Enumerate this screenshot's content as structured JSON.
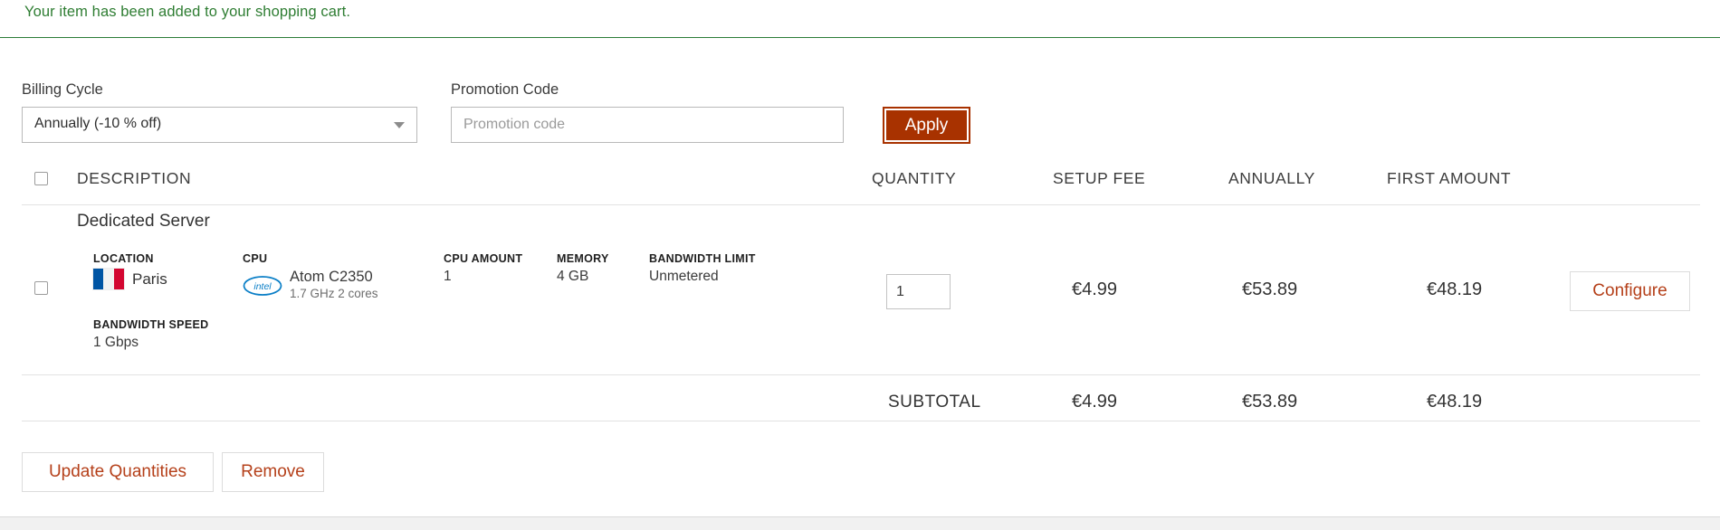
{
  "alert": {
    "message": "Your item has been added to your shopping cart.",
    "color": "#2e7d32"
  },
  "form": {
    "billing_cycle_label": "Billing Cycle",
    "billing_cycle_value": "Annually (-10 % off)",
    "promotion_label": "Promotion Code",
    "promotion_placeholder": "Promotion code",
    "promotion_value": "",
    "apply_label": "Apply",
    "apply_color": "#a83200"
  },
  "table": {
    "headers": {
      "description": "DESCRIPTION",
      "quantity": "QUANTITY",
      "setup_fee": "SETUP FEE",
      "annually": "ANNUALLY",
      "first_amount": "FIRST AMOUNT"
    },
    "item": {
      "title": "Dedicated Server",
      "quantity": "1",
      "setup_fee": "€4.99",
      "annually": "€53.89",
      "first_amount": "€48.19",
      "configure_label": "Configure",
      "specs": {
        "location_label": "LOCATION",
        "location_value": "Paris",
        "cpu_label": "CPU",
        "cpu_name": "Atom C2350",
        "cpu_detail": "1.7 GHz 2 cores",
        "cpu_amount_label": "CPU AMOUNT",
        "cpu_amount_value": "1",
        "memory_label": "MEMORY",
        "memory_value": "4 GB",
        "bandwidth_limit_label": "BANDWIDTH LIMIT",
        "bandwidth_limit_value": "Unmetered",
        "bandwidth_speed_label": "BANDWIDTH SPEED",
        "bandwidth_speed_value": "1 Gbps"
      }
    },
    "subtotal": {
      "label": "SUBTOTAL",
      "setup_fee": "€4.99",
      "annually": "€53.89",
      "first_amount": "€48.19"
    }
  },
  "actions": {
    "update_label": "Update Quantities",
    "remove_label": "Remove",
    "link_color": "#b5401a"
  }
}
